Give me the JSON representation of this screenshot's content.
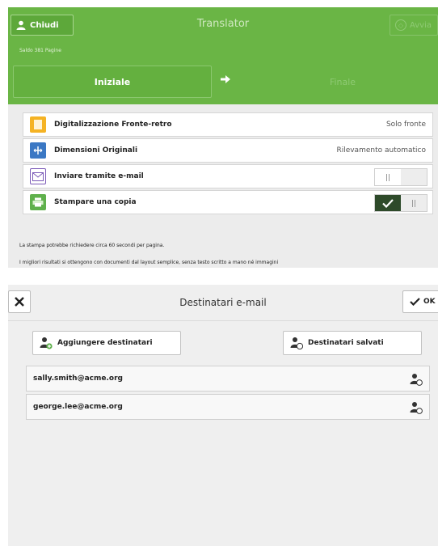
{
  "translator": {
    "close_label": "Chiudi",
    "title": "Translator",
    "start_label": "Avvia",
    "pages_label": "Saldo 381 Pagine",
    "source_lang": "Iniziale",
    "target_lang": "Finale",
    "settings": [
      {
        "label": "Digitalizzazione Fronte-retro",
        "value": "Solo fronte",
        "icon": "document-icon",
        "icon_color": "#f5b324"
      },
      {
        "label": "Dimensioni Originali",
        "value": "Rilevamento automatico",
        "icon": "size-icon",
        "icon_color": "#3b78c4"
      },
      {
        "label": "Inviare tramite e-mail",
        "value": "",
        "icon": "email-icon",
        "icon_color": "#7b5ab7",
        "toggle": "off"
      },
      {
        "label": "Stampare una copia",
        "value": "",
        "icon": "printer-icon",
        "icon_color": "#5fb04c",
        "toggle": "on"
      }
    ],
    "notes": [
      "La stampa potrebbe richiedere circa 60 secondi per pagina.",
      "I migliori risultati si ottengono con documenti dal layout semplice, senza testo scritto a mano né immagini"
    ]
  },
  "email": {
    "title": "Destinatari e-mail",
    "ok_label": "OK",
    "add_label": "Aggiungere destinatari",
    "saved_label": "Destinatari salvati",
    "recipients": [
      "sally.smith@acme.org",
      "george.lee@acme.org"
    ]
  },
  "colors": {
    "header_green": "#6ab545",
    "panel_gray": "#ececec",
    "toggle_on": "#2e4a2a"
  }
}
